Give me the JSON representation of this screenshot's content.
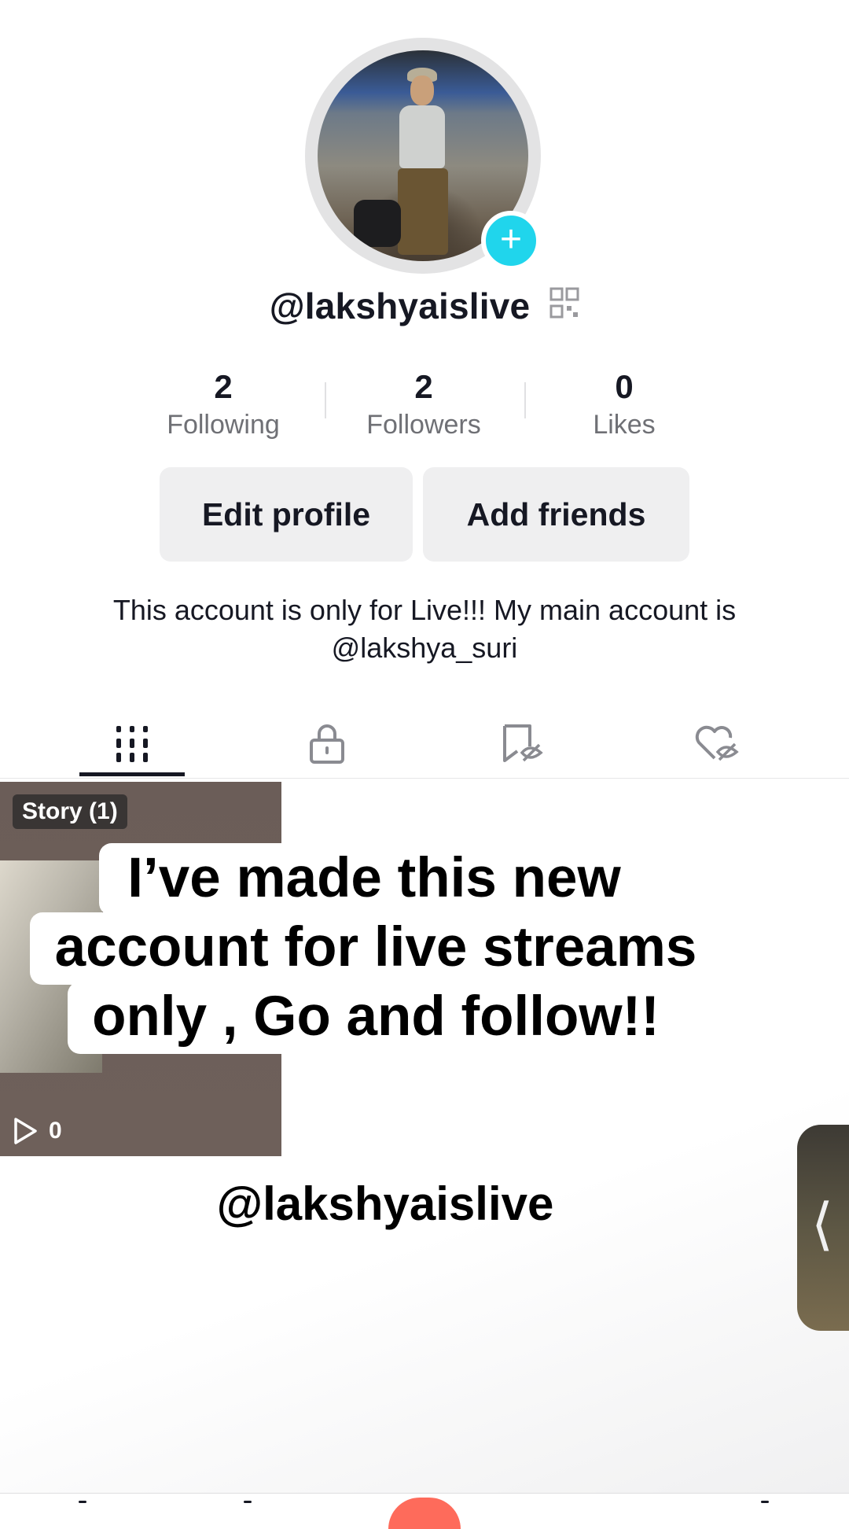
{
  "profile": {
    "username": "@lakshyaislive",
    "stats": [
      {
        "value": "2",
        "label": "Following"
      },
      {
        "value": "2",
        "label": "Followers"
      },
      {
        "value": "0",
        "label": "Likes"
      }
    ],
    "buttons": {
      "edit": "Edit profile",
      "add_friends": "Add friends"
    },
    "bio": "This account is only for Live!!!  My main account is @lakshya_suri"
  },
  "tabs": [
    {
      "icon": "grid-videos-icon",
      "selected": true
    },
    {
      "icon": "lock-icon",
      "selected": false
    },
    {
      "icon": "hidden-bookmark-icon",
      "selected": false
    },
    {
      "icon": "hidden-heart-icon",
      "selected": false
    }
  ],
  "grid": {
    "story_badge": "Story (1)",
    "play_count": "0"
  },
  "overlay": {
    "caption_lines": [
      "I’ve made this new",
      "account for live streams",
      "only , Go and follow!!"
    ],
    "handle": "@lakshyaislive"
  },
  "colors": {
    "accent_add": "#20d5ec",
    "tab_active": "#161823",
    "button_bg": "#efeff0"
  }
}
